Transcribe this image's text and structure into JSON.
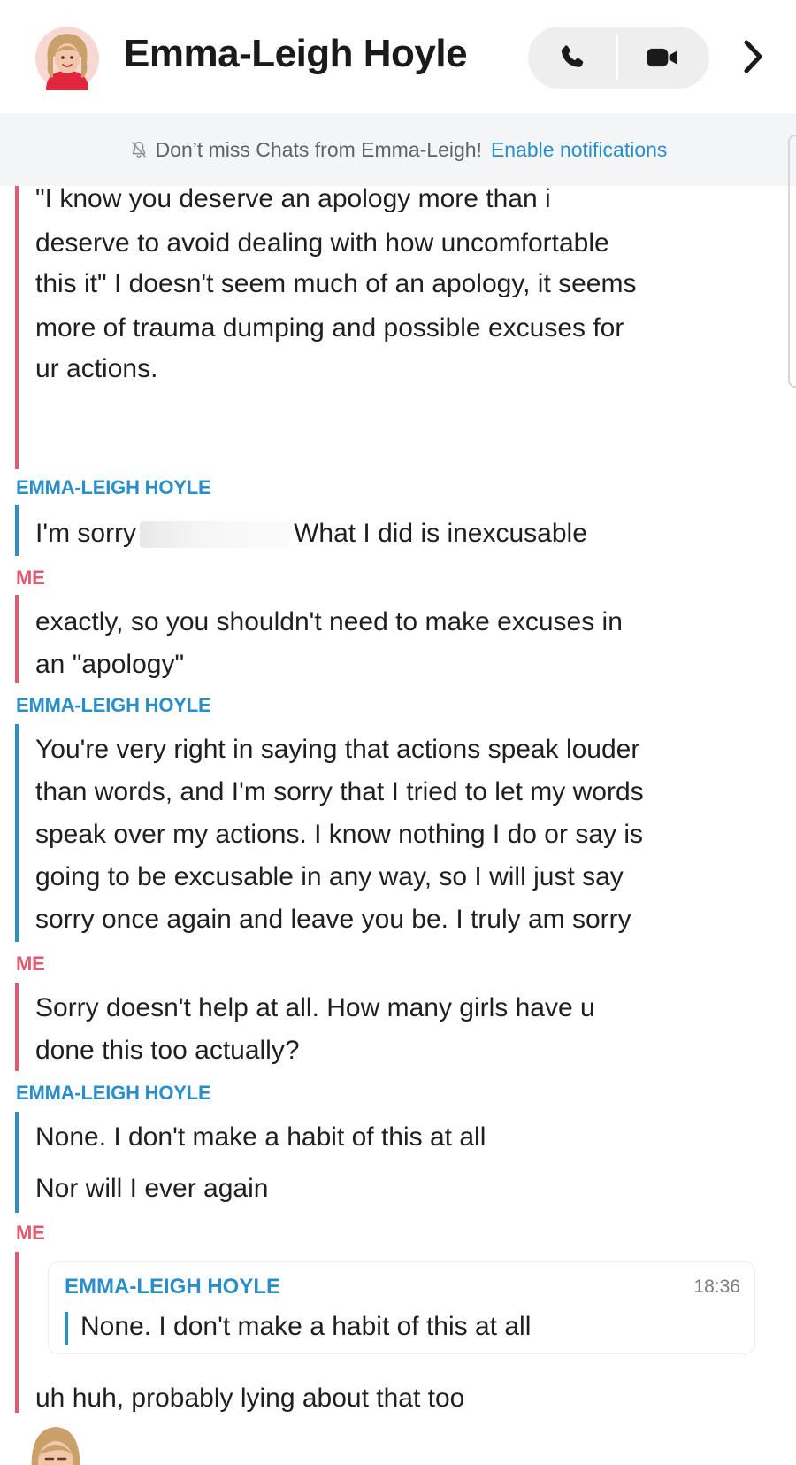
{
  "header": {
    "contact_name": "Emma-Leigh Hoyle",
    "avatar_icon": "bitmoji-avatar",
    "call_icon": "phone-icon",
    "video_icon": "video-camera-icon",
    "more_icon": "chevron-right-icon"
  },
  "notification_banner": {
    "icon": "bell-off-icon",
    "text": "Don’t miss Chats from Emma-Leigh!",
    "link": "Enable notifications"
  },
  "colors": {
    "me": "#e25a6f",
    "them": "#2a8ec8"
  },
  "messages": [
    {
      "from": "ME",
      "lines": [
        "\"I know you deserve an apology more than i",
        "deserve to avoid dealing with how uncomfortable",
        "this it\" I doesn't seem much of an apology, it seems",
        "more of trauma dumping and possible excuses for",
        "ur actions."
      ]
    },
    {
      "sender": "EMMA-LEIGH HOYLE",
      "before_redaction": "I'm sorry",
      "after_redaction": "What I did is inexcusable"
    },
    {
      "sender": "ME",
      "lines": [
        "exactly, so you shouldn't need to make excuses in",
        "an \"apology\""
      ]
    },
    {
      "sender": "EMMA-LEIGH HOYLE",
      "lines": [
        "You're very right in saying that actions speak louder",
        "than words, and I'm sorry that I tried to let my words",
        "speak over my actions. I know nothing I do or say is",
        "going to be excusable in any way, so I will just say",
        "sorry once again and leave you be. I truly am sorry"
      ]
    },
    {
      "sender": "ME",
      "lines": [
        "Sorry doesn't help at all. How many girls have u",
        "done this too actually?"
      ]
    },
    {
      "sender": "EMMA-LEIGH HOYLE",
      "lines": [
        "None. I don't make a habit of this at all",
        "Nor will I ever again"
      ]
    },
    {
      "sender": "ME",
      "quote": {
        "sender": "EMMA-LEIGH HOYLE",
        "time": "18:36",
        "text": "None. I don't make a habit of this at all"
      },
      "lines": [
        "uh huh, probably lying about that too"
      ]
    }
  ]
}
